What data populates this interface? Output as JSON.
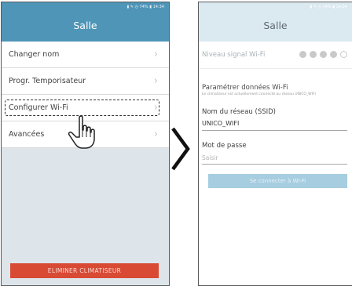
{
  "left_screen": {
    "status_text": "▮ ✎ ◷ 74% ▮ 14:34",
    "title": "Salle",
    "menu": [
      {
        "label": "Changer nom",
        "chevron": "›"
      },
      {
        "label": "Progr. Temporisateur",
        "chevron": "›"
      },
      {
        "label": "Configurer Wi-Fi",
        "chevron": "›"
      },
      {
        "label": "Avancées",
        "chevron": "›"
      }
    ],
    "delete_button": "ELIMINER CLIMATISEUR",
    "colors": {
      "header": "#4f95b7",
      "delete": "#d94a35"
    }
  },
  "right_screen": {
    "status_text": "▮ ✎ ◷ 74% ▮ 14:34",
    "title": "Salle",
    "signal_label": "Niveau signal Wi-Fi",
    "signal_level": 4,
    "signal_max": 5,
    "wifi_settings_title": "Paramétrer données Wi-Fi",
    "wifi_settings_desc": "Le climatiseur est actuellement connecté au réseau UNICO_WIFI",
    "ssid_label": "Nom du réseau (SSID)",
    "ssid_value": "UNICO_WIFI",
    "password_label": "Mot de passe",
    "password_placeholder": "Saisir",
    "connect_button": "Se connecter à Wi-Fi",
    "colors": {
      "header": "#dbe9f0",
      "button": "#a6cde0"
    }
  },
  "icons": {
    "pointer": "hand-pointer-icon",
    "navigation": "chevron-right-icon"
  }
}
